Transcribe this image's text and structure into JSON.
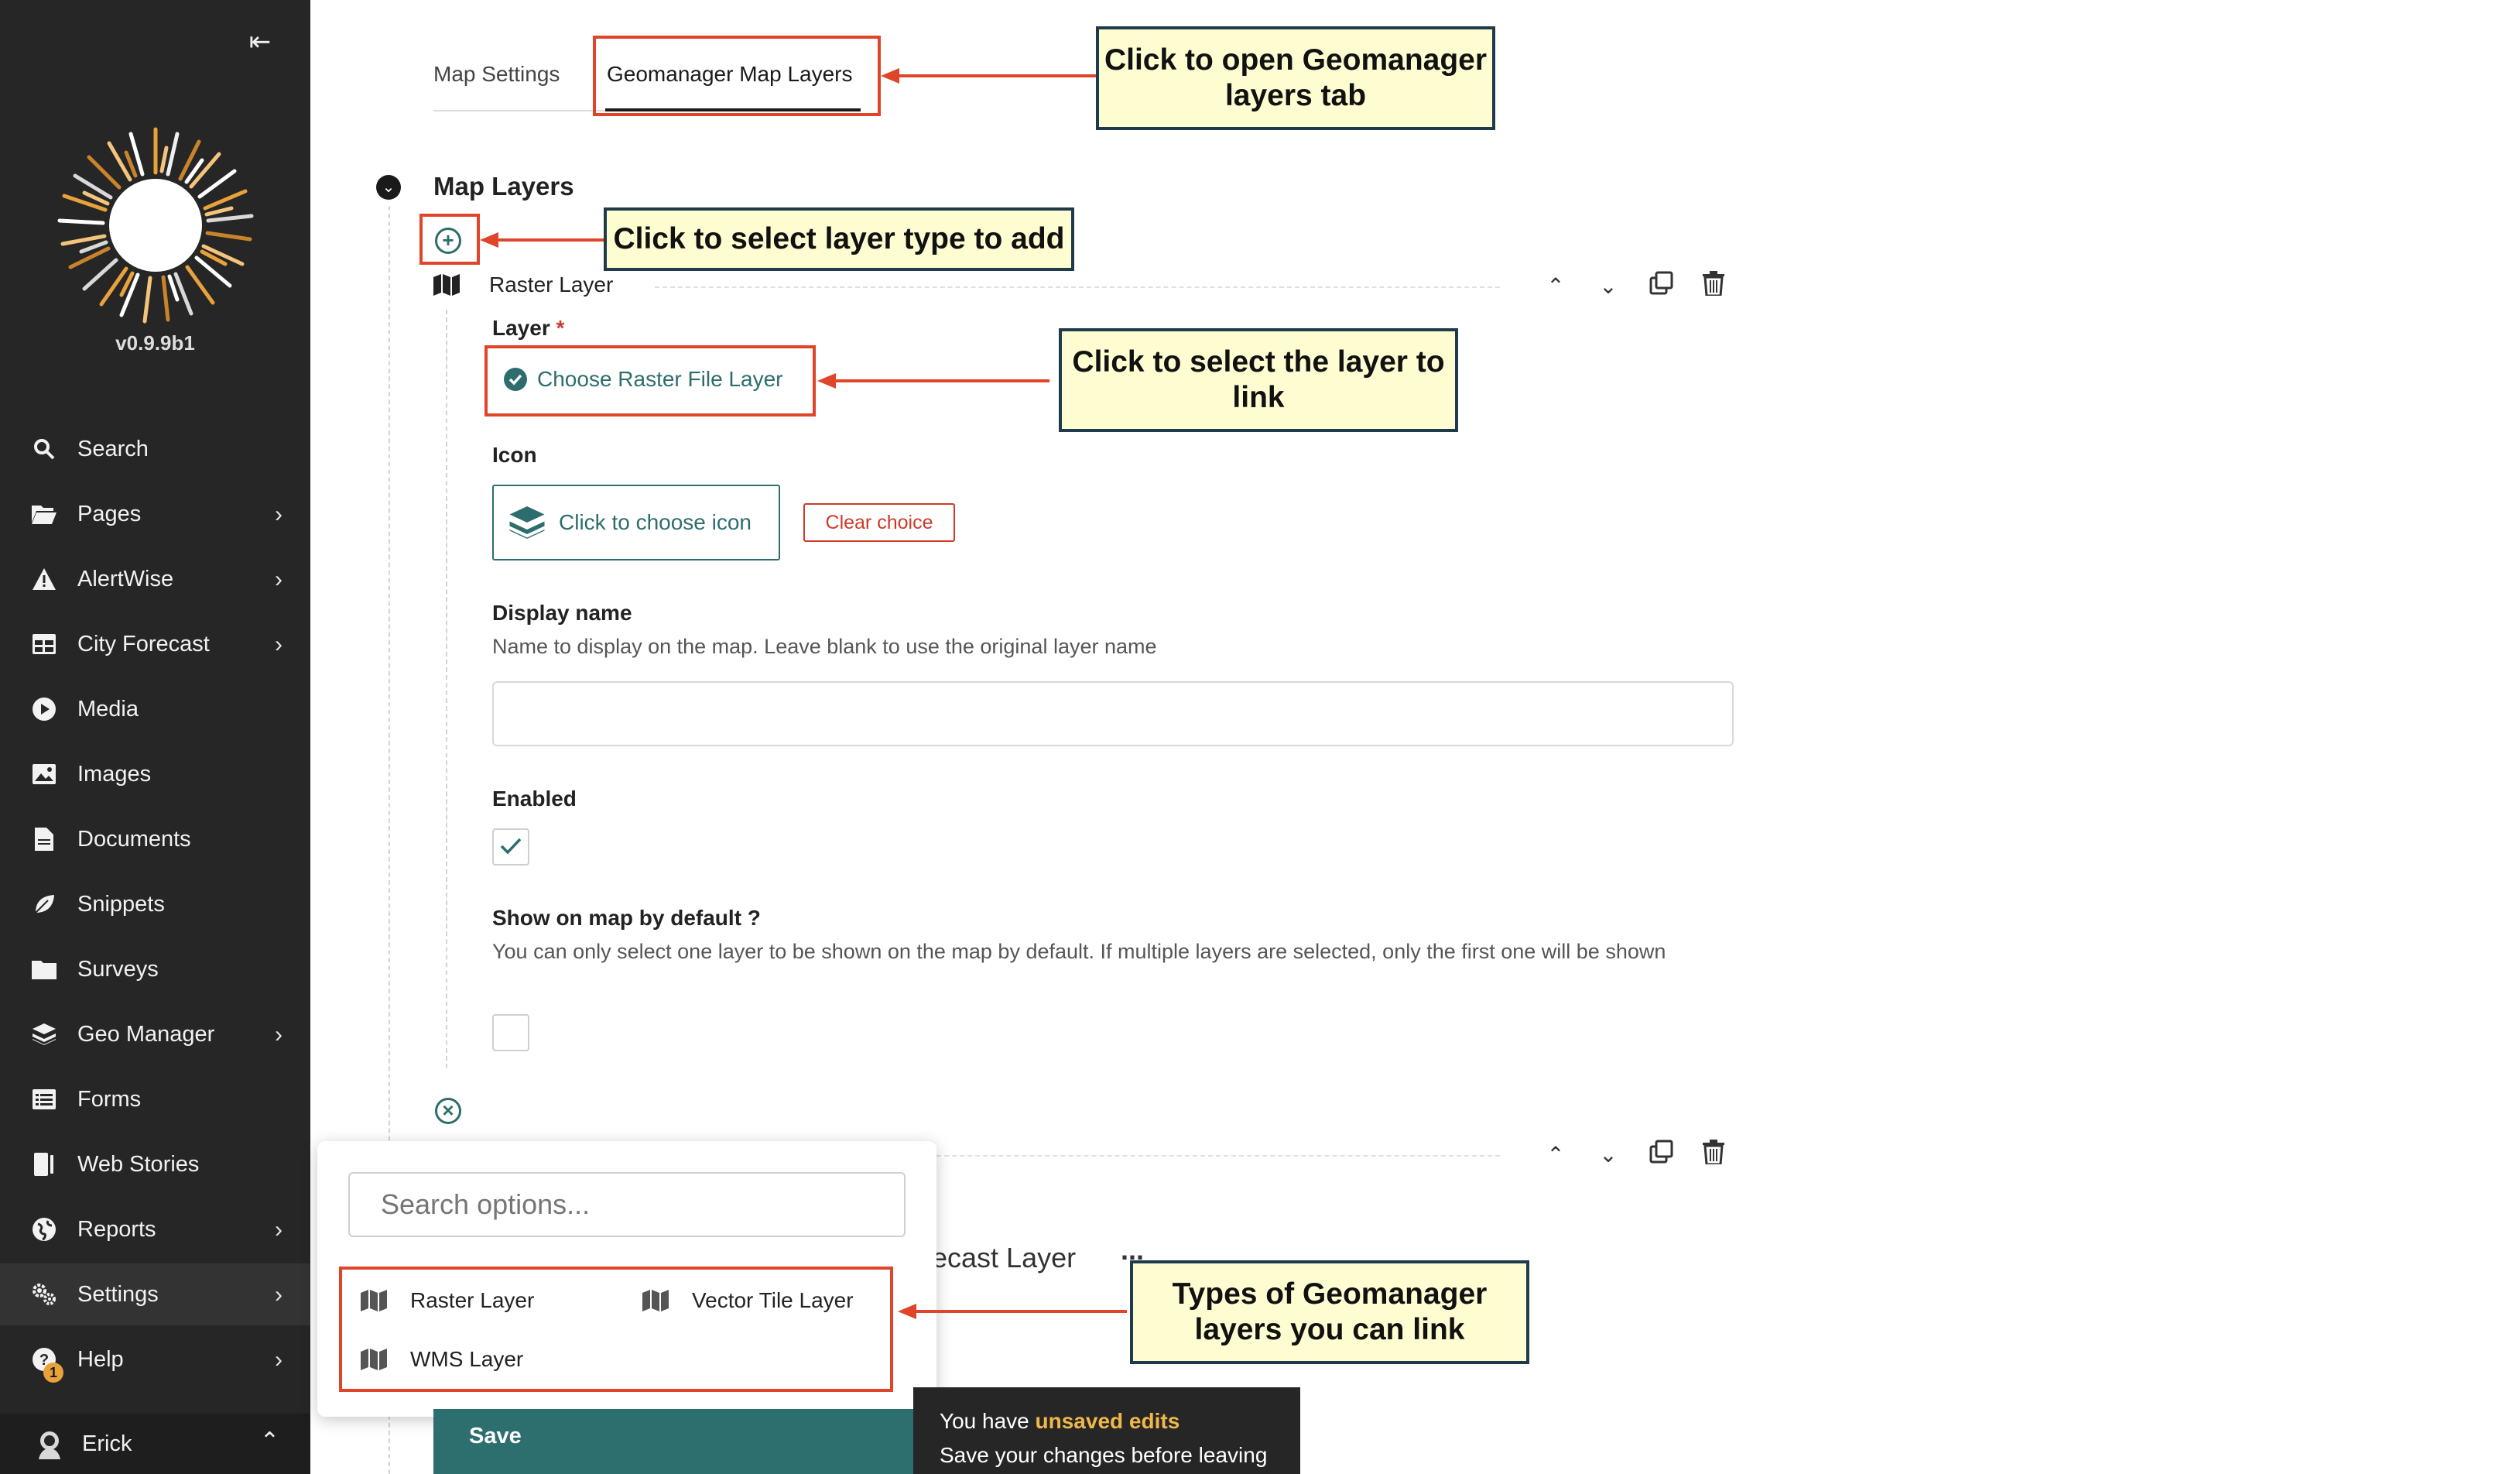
{
  "sidebar": {
    "version": "v0.9.9b1",
    "items": [
      {
        "label": "Search",
        "icon": "search-icon"
      },
      {
        "label": "Pages",
        "icon": "folder-open-icon"
      },
      {
        "label": "AlertWise",
        "icon": "warning-icon"
      },
      {
        "label": "City Forecast",
        "icon": "table-icon"
      },
      {
        "label": "Media",
        "icon": "play-icon"
      },
      {
        "label": "Images",
        "icon": "image-icon"
      },
      {
        "label": "Documents",
        "icon": "document-icon"
      },
      {
        "label": "Snippets",
        "icon": "leaf-icon"
      },
      {
        "label": "Surveys",
        "icon": "folder-icon"
      },
      {
        "label": "Geo Manager",
        "icon": "layers-icon"
      },
      {
        "label": "Forms",
        "icon": "list-icon"
      },
      {
        "label": "Web Stories",
        "icon": "stories-icon"
      },
      {
        "label": "Reports",
        "icon": "globe-icon"
      },
      {
        "label": "Settings",
        "icon": "cogs-icon"
      },
      {
        "label": "Help",
        "icon": "help-icon"
      }
    ],
    "help_badge": "1",
    "user_name": "Erick"
  },
  "tabs": {
    "map_settings": "Map Settings",
    "geomanager_layers": "Geomanager Map Layers"
  },
  "callouts": {
    "open_tab": "Click to open Geomanager layers tab",
    "select_type": "Click to select layer type to add",
    "select_layer": "Click to select the layer to link",
    "types": "Types of Geomanager layers you can link"
  },
  "section": {
    "title": "Map Layers"
  },
  "block": {
    "title": "Raster Layer",
    "layer_label": "Layer",
    "required_mark": "*",
    "choose_layer": "Choose Raster File Layer",
    "icon_label": "Icon",
    "choose_icon": "Click to choose icon",
    "clear_choice": "Clear choice",
    "display_name_label": "Display name",
    "display_name_help": "Name to display on the map. Leave blank to use the original layer name",
    "display_name_value": "",
    "enabled_label": "Enabled",
    "show_default_label": "Show on map by default ?",
    "show_default_help": "You can only select one layer to be shown on the map by default. If multiple layers are selected, only the first one will be shown"
  },
  "dropdown": {
    "search_placeholder": "Search options...",
    "options": [
      "Raster Layer",
      "Vector Tile Layer",
      "WMS Layer"
    ]
  },
  "behind": {
    "partial_title": "ecast Layer",
    "ellipsis": "..."
  },
  "footer": {
    "save": "Save",
    "unsaved_prefix": "You have ",
    "unsaved_highlight": "unsaved edits",
    "unsaved_hint": "Save your changes before leaving"
  }
}
